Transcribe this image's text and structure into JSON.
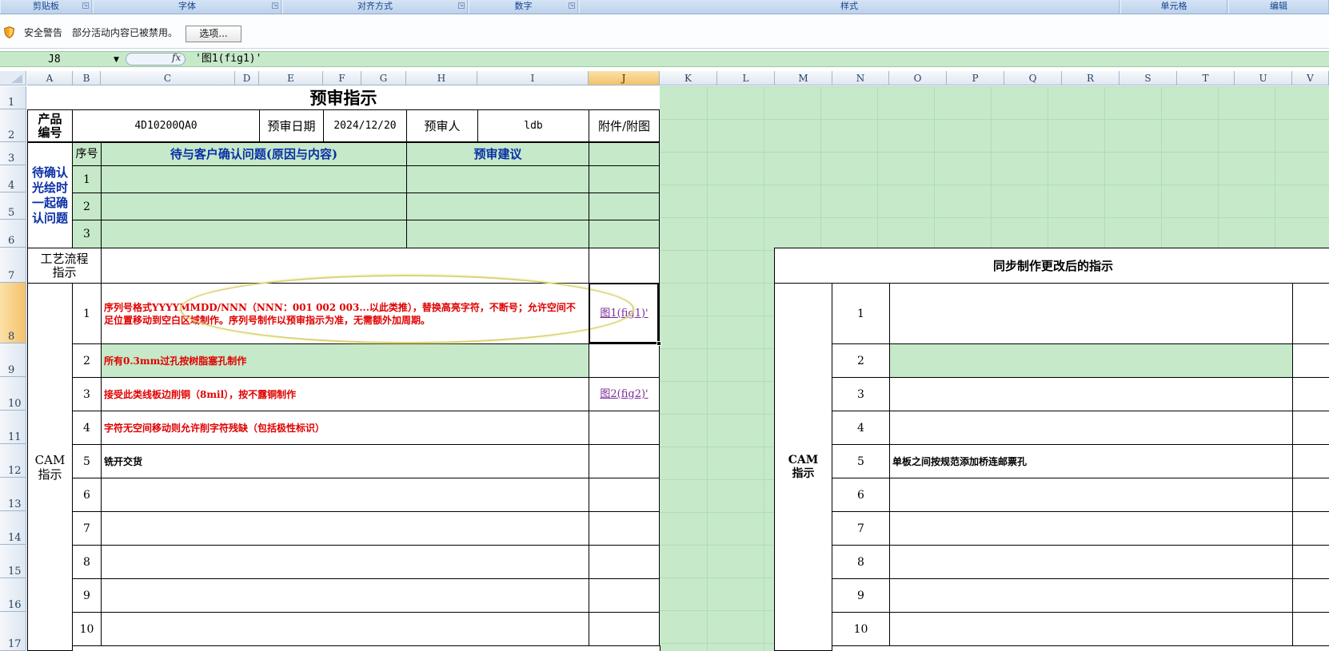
{
  "ribbon": {
    "groups": [
      "剪贴板",
      "字体",
      "对齐方式",
      "数字",
      "样式",
      "单元格",
      "编辑"
    ]
  },
  "security_bar": {
    "icon": "shield-warning-icon",
    "title": "安全警告",
    "message": "部分活动内容已被禁用。",
    "options_button": "选项..."
  },
  "formula_bar": {
    "name_box": "J8",
    "fx_label": "fx",
    "formula": "'图1(fig1)'"
  },
  "columns": [
    "A",
    "B",
    "C",
    "D",
    "E",
    "F",
    "G",
    "H",
    "I",
    "J",
    "K",
    "L",
    "M",
    "N",
    "O",
    "P",
    "Q",
    "R",
    "S",
    "T",
    "U",
    "V"
  ],
  "selected_column": "J",
  "rows": [
    "1",
    "2",
    "3",
    "4",
    "5",
    "6",
    "7",
    "8",
    "9",
    "10",
    "11",
    "12",
    "13",
    "14",
    "15",
    "16",
    "17"
  ],
  "selected_row": "8",
  "sheet": {
    "title": "预审指示",
    "product_no_label": "产品编号",
    "product_no": "4D10200QA0",
    "review_date_label": "预审日期",
    "review_date": "2024/12/20",
    "reviewer_label": "预审人",
    "reviewer": "ldb",
    "attachment_label": "附件/附图",
    "confirm_section_label": "待确认光绘时一起确认问题",
    "seq_label": "序号",
    "issue_header": "待与客户确认问题(原因与内容)",
    "suggestion_header": "预审建议",
    "confirm_rows": [
      "1",
      "2",
      "3"
    ],
    "process_label": "工艺流程指示",
    "cam_label": "CAM指示",
    "cam_rows": [
      {
        "no": "1",
        "text": "序列号格式YYYYMMDD/NNN（NNN：001 002 003...以此类推），替换高亮字符，不断号；允许空间不足位置移动到空白区域制作。序列号制作以预审指示为准，无需额外加周期。",
        "link": "图1(fig1)'"
      },
      {
        "no": "2",
        "text": "所有0.3mm过孔按树脂塞孔制作",
        "link": ""
      },
      {
        "no": "3",
        "text": "接受此类线板边削铜（8mil），按不露铜制作",
        "link": "图2(fig2)'"
      },
      {
        "no": "4",
        "text": "字符无空间移动则允许削字符残缺（包括极性标识）",
        "link": ""
      },
      {
        "no": "5",
        "text": "铣开交货",
        "link": ""
      },
      {
        "no": "6",
        "text": "",
        "link": ""
      },
      {
        "no": "7",
        "text": "",
        "link": ""
      },
      {
        "no": "8",
        "text": "",
        "link": ""
      },
      {
        "no": "9",
        "text": "",
        "link": ""
      },
      {
        "no": "10",
        "text": "",
        "link": ""
      }
    ],
    "sync_header": "同步制作更改后的指示",
    "sync_cam_label": "CAM指示",
    "sync_rows": [
      {
        "no": "1",
        "text": ""
      },
      {
        "no": "2",
        "text": ""
      },
      {
        "no": "3",
        "text": ""
      },
      {
        "no": "4",
        "text": ""
      },
      {
        "no": "5",
        "text": "单板之间按规范添加桥连邮票孔"
      },
      {
        "no": "6",
        "text": ""
      },
      {
        "no": "7",
        "text": ""
      },
      {
        "no": "8",
        "text": ""
      },
      {
        "no": "9",
        "text": ""
      },
      {
        "no": "10",
        "text": ""
      }
    ]
  },
  "colors": {
    "sheet_green": "#c6e9c9",
    "instruction_red": "#e00000",
    "header_blue": "#0a2fa6",
    "link_purple": "#7a2b9a",
    "highlight_ellipse": "#d9d27a"
  }
}
